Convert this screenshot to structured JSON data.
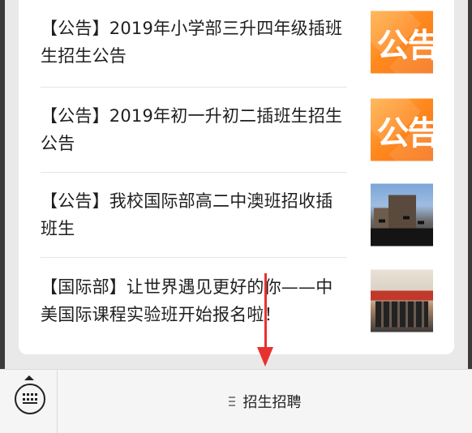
{
  "articles": [
    {
      "title": "【公告】2019年小学部三升四年级插班生招生公告",
      "thumb_text": "公告",
      "thumb": "notice-icon"
    },
    {
      "title": "【公告】2019年初一升初二插班生招生公告",
      "thumb_text": "公告",
      "thumb": "notice-icon"
    },
    {
      "title": "【公告】我校国际部高二中澳班招收插班生",
      "thumb": "graduation-photo"
    },
    {
      "title": "【国际部】让世界遇见更好的你——中美国际课程实验班开始报名啦！",
      "thumb": "meeting-photo"
    }
  ],
  "bottom_menu": {
    "keyboard_icon": "keyboard-toggle-icon",
    "items": [
      {
        "label": "招生招聘",
        "icon": "menu-list-icon"
      }
    ]
  },
  "colors": {
    "accent_arrow": "#e8312f",
    "notice_orange": "#ff8a1f",
    "card_bg": "#ffffff",
    "bar_bg": "#f5f5f5"
  }
}
